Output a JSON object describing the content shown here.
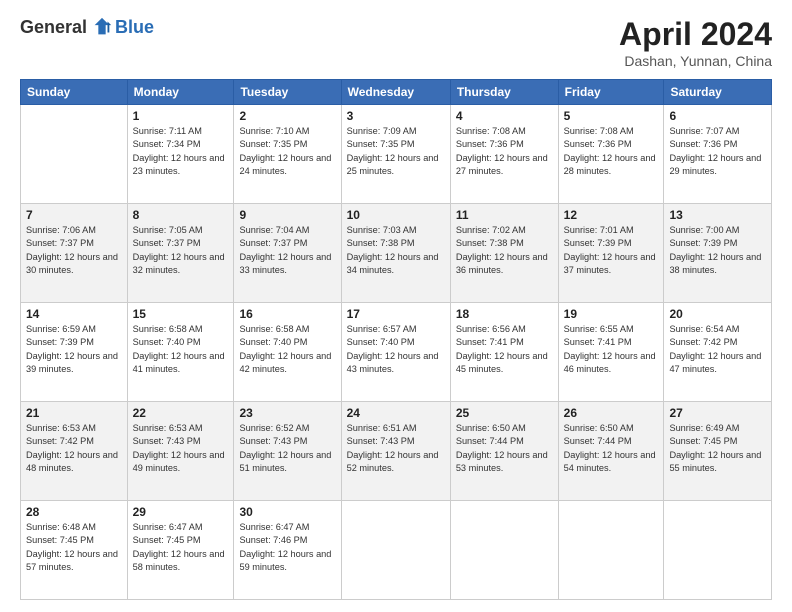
{
  "header": {
    "logo_general": "General",
    "logo_blue": "Blue",
    "month_title": "April 2024",
    "location": "Dashan, Yunnan, China"
  },
  "days_of_week": [
    "Sunday",
    "Monday",
    "Tuesday",
    "Wednesday",
    "Thursday",
    "Friday",
    "Saturday"
  ],
  "weeks": [
    [
      {
        "day": "",
        "sunrise": "",
        "sunset": "",
        "daylight": ""
      },
      {
        "day": "1",
        "sunrise": "Sunrise: 7:11 AM",
        "sunset": "Sunset: 7:34 PM",
        "daylight": "Daylight: 12 hours and 23 minutes."
      },
      {
        "day": "2",
        "sunrise": "Sunrise: 7:10 AM",
        "sunset": "Sunset: 7:35 PM",
        "daylight": "Daylight: 12 hours and 24 minutes."
      },
      {
        "day": "3",
        "sunrise": "Sunrise: 7:09 AM",
        "sunset": "Sunset: 7:35 PM",
        "daylight": "Daylight: 12 hours and 25 minutes."
      },
      {
        "day": "4",
        "sunrise": "Sunrise: 7:08 AM",
        "sunset": "Sunset: 7:36 PM",
        "daylight": "Daylight: 12 hours and 27 minutes."
      },
      {
        "day": "5",
        "sunrise": "Sunrise: 7:08 AM",
        "sunset": "Sunset: 7:36 PM",
        "daylight": "Daylight: 12 hours and 28 minutes."
      },
      {
        "day": "6",
        "sunrise": "Sunrise: 7:07 AM",
        "sunset": "Sunset: 7:36 PM",
        "daylight": "Daylight: 12 hours and 29 minutes."
      }
    ],
    [
      {
        "day": "7",
        "sunrise": "Sunrise: 7:06 AM",
        "sunset": "Sunset: 7:37 PM",
        "daylight": "Daylight: 12 hours and 30 minutes."
      },
      {
        "day": "8",
        "sunrise": "Sunrise: 7:05 AM",
        "sunset": "Sunset: 7:37 PM",
        "daylight": "Daylight: 12 hours and 32 minutes."
      },
      {
        "day": "9",
        "sunrise": "Sunrise: 7:04 AM",
        "sunset": "Sunset: 7:37 PM",
        "daylight": "Daylight: 12 hours and 33 minutes."
      },
      {
        "day": "10",
        "sunrise": "Sunrise: 7:03 AM",
        "sunset": "Sunset: 7:38 PM",
        "daylight": "Daylight: 12 hours and 34 minutes."
      },
      {
        "day": "11",
        "sunrise": "Sunrise: 7:02 AM",
        "sunset": "Sunset: 7:38 PM",
        "daylight": "Daylight: 12 hours and 36 minutes."
      },
      {
        "day": "12",
        "sunrise": "Sunrise: 7:01 AM",
        "sunset": "Sunset: 7:39 PM",
        "daylight": "Daylight: 12 hours and 37 minutes."
      },
      {
        "day": "13",
        "sunrise": "Sunrise: 7:00 AM",
        "sunset": "Sunset: 7:39 PM",
        "daylight": "Daylight: 12 hours and 38 minutes."
      }
    ],
    [
      {
        "day": "14",
        "sunrise": "Sunrise: 6:59 AM",
        "sunset": "Sunset: 7:39 PM",
        "daylight": "Daylight: 12 hours and 39 minutes."
      },
      {
        "day": "15",
        "sunrise": "Sunrise: 6:58 AM",
        "sunset": "Sunset: 7:40 PM",
        "daylight": "Daylight: 12 hours and 41 minutes."
      },
      {
        "day": "16",
        "sunrise": "Sunrise: 6:58 AM",
        "sunset": "Sunset: 7:40 PM",
        "daylight": "Daylight: 12 hours and 42 minutes."
      },
      {
        "day": "17",
        "sunrise": "Sunrise: 6:57 AM",
        "sunset": "Sunset: 7:40 PM",
        "daylight": "Daylight: 12 hours and 43 minutes."
      },
      {
        "day": "18",
        "sunrise": "Sunrise: 6:56 AM",
        "sunset": "Sunset: 7:41 PM",
        "daylight": "Daylight: 12 hours and 45 minutes."
      },
      {
        "day": "19",
        "sunrise": "Sunrise: 6:55 AM",
        "sunset": "Sunset: 7:41 PM",
        "daylight": "Daylight: 12 hours and 46 minutes."
      },
      {
        "day": "20",
        "sunrise": "Sunrise: 6:54 AM",
        "sunset": "Sunset: 7:42 PM",
        "daylight": "Daylight: 12 hours and 47 minutes."
      }
    ],
    [
      {
        "day": "21",
        "sunrise": "Sunrise: 6:53 AM",
        "sunset": "Sunset: 7:42 PM",
        "daylight": "Daylight: 12 hours and 48 minutes."
      },
      {
        "day": "22",
        "sunrise": "Sunrise: 6:53 AM",
        "sunset": "Sunset: 7:43 PM",
        "daylight": "Daylight: 12 hours and 49 minutes."
      },
      {
        "day": "23",
        "sunrise": "Sunrise: 6:52 AM",
        "sunset": "Sunset: 7:43 PM",
        "daylight": "Daylight: 12 hours and 51 minutes."
      },
      {
        "day": "24",
        "sunrise": "Sunrise: 6:51 AM",
        "sunset": "Sunset: 7:43 PM",
        "daylight": "Daylight: 12 hours and 52 minutes."
      },
      {
        "day": "25",
        "sunrise": "Sunrise: 6:50 AM",
        "sunset": "Sunset: 7:44 PM",
        "daylight": "Daylight: 12 hours and 53 minutes."
      },
      {
        "day": "26",
        "sunrise": "Sunrise: 6:50 AM",
        "sunset": "Sunset: 7:44 PM",
        "daylight": "Daylight: 12 hours and 54 minutes."
      },
      {
        "day": "27",
        "sunrise": "Sunrise: 6:49 AM",
        "sunset": "Sunset: 7:45 PM",
        "daylight": "Daylight: 12 hours and 55 minutes."
      }
    ],
    [
      {
        "day": "28",
        "sunrise": "Sunrise: 6:48 AM",
        "sunset": "Sunset: 7:45 PM",
        "daylight": "Daylight: 12 hours and 57 minutes."
      },
      {
        "day": "29",
        "sunrise": "Sunrise: 6:47 AM",
        "sunset": "Sunset: 7:45 PM",
        "daylight": "Daylight: 12 hours and 58 minutes."
      },
      {
        "day": "30",
        "sunrise": "Sunrise: 6:47 AM",
        "sunset": "Sunset: 7:46 PM",
        "daylight": "Daylight: 12 hours and 59 minutes."
      },
      {
        "day": "",
        "sunrise": "",
        "sunset": "",
        "daylight": ""
      },
      {
        "day": "",
        "sunrise": "",
        "sunset": "",
        "daylight": ""
      },
      {
        "day": "",
        "sunrise": "",
        "sunset": "",
        "daylight": ""
      },
      {
        "day": "",
        "sunrise": "",
        "sunset": "",
        "daylight": ""
      }
    ]
  ]
}
